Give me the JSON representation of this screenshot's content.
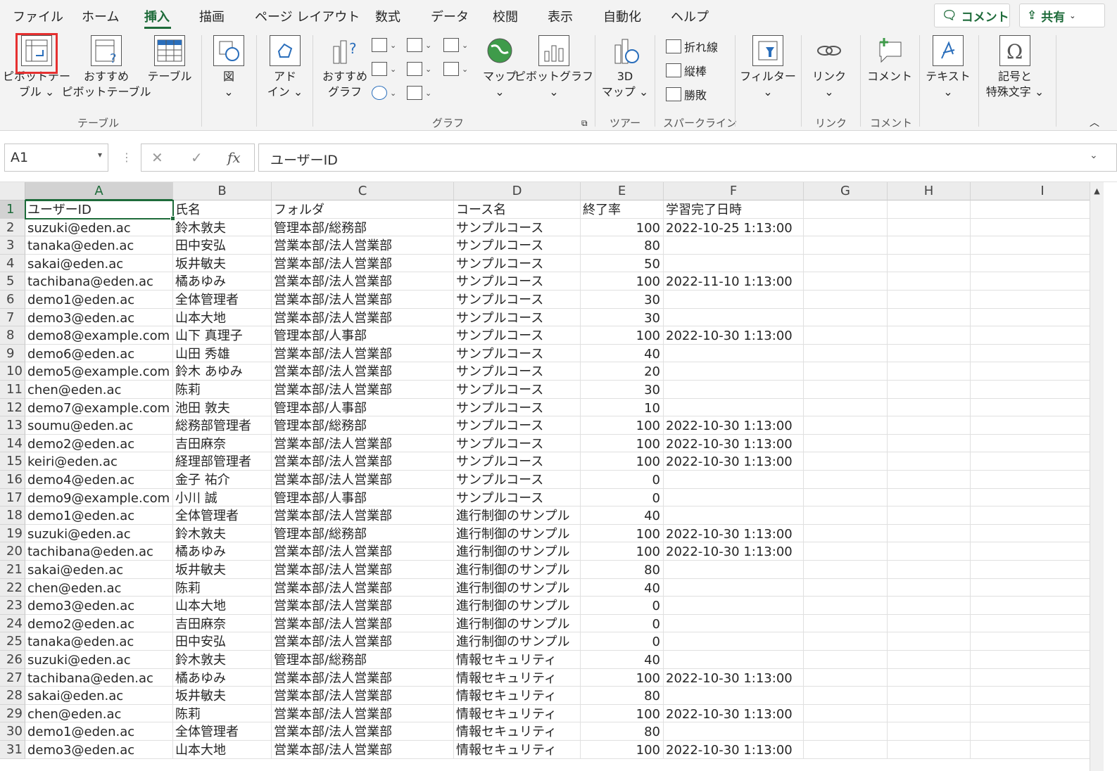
{
  "menubar": {
    "tabs": [
      "ファイル",
      "ホーム",
      "挿入",
      "描画",
      "ページ レイアウト",
      "数式",
      "データ",
      "校閲",
      "表示",
      "自動化",
      "ヘルプ"
    ],
    "active_tab": "挿入",
    "comment_button": "コメント",
    "share_button": "共有"
  },
  "ribbon": {
    "pivot_table": "ピボットテー\nブル ⌄",
    "recommended_pivot": "おすすめ\nピボットテーブル",
    "table": "テーブル",
    "figure": "図\n⌄",
    "addin": "アド\nイン ⌄",
    "recommended_chart": "おすすめ\nグラフ",
    "map": "マップ\n⌄",
    "pivot_chart": "ピボットグラフ\n⌄",
    "map3d": "3D\nマップ ⌄",
    "spark_line": "折れ線",
    "spark_column": "縦棒",
    "spark_winloss": "勝敗",
    "filter": "フィルター\n⌄",
    "link": "リンク\n⌄",
    "comment": "コメント",
    "text": "テキスト\n⌄",
    "symbol": "記号と\n特殊文字 ⌄",
    "groups": {
      "table": "テーブル",
      "chart": "グラフ",
      "tour": "ツアー",
      "sparkline": "スパークライン",
      "link": "リンク",
      "comment": "コメント"
    }
  },
  "formula_bar": {
    "name_box": "A1",
    "cancel_glyph": "✕",
    "enter_glyph": "✓",
    "fx_glyph": "fx",
    "formula": "ユーザーID"
  },
  "sheet": {
    "columns": [
      "A",
      "B",
      "C",
      "D",
      "E",
      "F",
      "G",
      "H",
      "I"
    ],
    "selected_cell": "A1",
    "rows": [
      [
        "ユーザーID",
        "氏名",
        "フォルダ",
        "コース名",
        "終了率",
        "学習完了日時"
      ],
      [
        "suzuki@eden.ac",
        "鈴木敦夫",
        "管理本部/総務部",
        "サンプルコース",
        "100",
        "2022-10-25 1:13:00"
      ],
      [
        "tanaka@eden.ac",
        "田中安弘",
        "営業本部/法人営業部",
        "サンプルコース",
        "80",
        ""
      ],
      [
        "sakai@eden.ac",
        "坂井敏夫",
        "営業本部/法人営業部",
        "サンプルコース",
        "50",
        ""
      ],
      [
        "tachibana@eden.ac",
        "橘あゆみ",
        "営業本部/法人営業部",
        "サンプルコース",
        "100",
        "2022-11-10 1:13:00"
      ],
      [
        "demo1@eden.ac",
        "全体管理者",
        "営業本部/法人営業部",
        "サンプルコース",
        "30",
        ""
      ],
      [
        "demo3@eden.ac",
        "山本大地",
        "営業本部/法人営業部",
        "サンプルコース",
        "30",
        ""
      ],
      [
        "demo8@example.com",
        "山下 真理子",
        "管理本部/人事部",
        "サンプルコース",
        "100",
        "2022-10-30 1:13:00"
      ],
      [
        "demo6@eden.ac",
        "山田 秀雄",
        "営業本部/法人営業部",
        "サンプルコース",
        "40",
        ""
      ],
      [
        "demo5@example.com",
        "鈴木 あゆみ",
        "営業本部/法人営業部",
        "サンプルコース",
        "20",
        ""
      ],
      [
        "chen@eden.ac",
        "陈莉",
        "営業本部/法人営業部",
        "サンプルコース",
        "30",
        ""
      ],
      [
        "demo7@example.com",
        "池田 敦夫",
        "管理本部/人事部",
        "サンプルコース",
        "10",
        ""
      ],
      [
        "soumu@eden.ac",
        "総務部管理者",
        "管理本部/総務部",
        "サンプルコース",
        "100",
        "2022-10-30 1:13:00"
      ],
      [
        "demo2@eden.ac",
        "吉田麻奈",
        "営業本部/法人営業部",
        "サンプルコース",
        "100",
        "2022-10-30 1:13:00"
      ],
      [
        "keiri@eden.ac",
        "経理部管理者",
        "営業本部/法人営業部",
        "サンプルコース",
        "100",
        "2022-10-30 1:13:00"
      ],
      [
        "demo4@eden.ac",
        "金子 祐介",
        "営業本部/法人営業部",
        "サンプルコース",
        "0",
        ""
      ],
      [
        "demo9@example.com",
        "小川 誠",
        "管理本部/人事部",
        "サンプルコース",
        "0",
        ""
      ],
      [
        "demo1@eden.ac",
        "全体管理者",
        "営業本部/法人営業部",
        "進行制御のサンプル",
        "40",
        ""
      ],
      [
        "suzuki@eden.ac",
        "鈴木敦夫",
        "管理本部/総務部",
        "進行制御のサンプル",
        "100",
        "2022-10-30 1:13:00"
      ],
      [
        "tachibana@eden.ac",
        "橘あゆみ",
        "営業本部/法人営業部",
        "進行制御のサンプル",
        "100",
        "2022-10-30 1:13:00"
      ],
      [
        "sakai@eden.ac",
        "坂井敏夫",
        "営業本部/法人営業部",
        "進行制御のサンプル",
        "80",
        ""
      ],
      [
        "chen@eden.ac",
        "陈莉",
        "営業本部/法人営業部",
        "進行制御のサンプル",
        "40",
        ""
      ],
      [
        "demo3@eden.ac",
        "山本大地",
        "営業本部/法人営業部",
        "進行制御のサンプル",
        "0",
        ""
      ],
      [
        "demo2@eden.ac",
        "吉田麻奈",
        "営業本部/法人営業部",
        "進行制御のサンプル",
        "0",
        ""
      ],
      [
        "tanaka@eden.ac",
        "田中安弘",
        "営業本部/法人営業部",
        "進行制御のサンプル",
        "0",
        ""
      ],
      [
        "suzuki@eden.ac",
        "鈴木敦夫",
        "管理本部/総務部",
        "情報セキュリティ",
        "40",
        ""
      ],
      [
        "tachibana@eden.ac",
        "橘あゆみ",
        "営業本部/法人営業部",
        "情報セキュリティ",
        "100",
        "2022-10-30 1:13:00"
      ],
      [
        "sakai@eden.ac",
        "坂井敏夫",
        "営業本部/法人営業部",
        "情報セキュリティ",
        "80",
        ""
      ],
      [
        "chen@eden.ac",
        "陈莉",
        "営業本部/法人営業部",
        "情報セキュリティ",
        "100",
        "2022-10-30 1:13:00"
      ],
      [
        "demo1@eden.ac",
        "全体管理者",
        "営業本部/法人営業部",
        "情報セキュリティ",
        "80",
        ""
      ],
      [
        "demo3@eden.ac",
        "山本大地",
        "営業本部/法人営業部",
        "情報セキュリティ",
        "100",
        "2022-10-30 1:13:00"
      ]
    ]
  },
  "colors": {
    "accent": "#1e6b3a",
    "highlight": "#e53030"
  }
}
